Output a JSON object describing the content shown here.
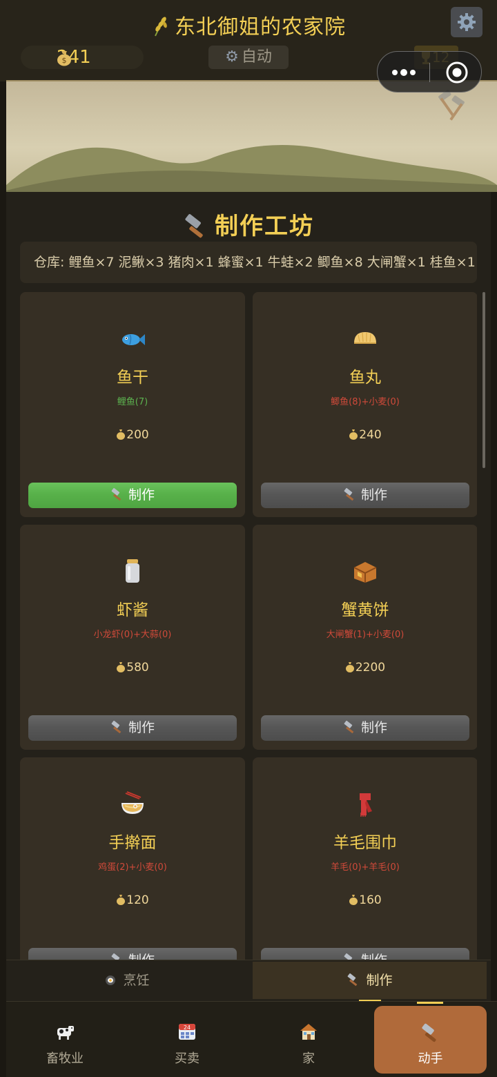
{
  "header": {
    "title": "东北御姐的农家院",
    "coins": "241",
    "auto_label": "自动",
    "trophy_count": "12"
  },
  "workshop": {
    "title": "制作工坊",
    "warehouse_text": "仓库: 鲤鱼×7 泥鳅×3 猪肉×1 蜂蜜×1 牛蛙×2 鲫鱼×8 大闸蟹×1 桂鱼×1 ...",
    "recipes": [
      {
        "name": "鱼干",
        "requires": "鲤鱼(7)",
        "price": "200",
        "button": "制作",
        "icon": "fish-icon",
        "ready": true
      },
      {
        "name": "鱼丸",
        "requires": "鲫鱼(8)+小麦(0)",
        "price": "240",
        "button": "制作",
        "icon": "dumpling-icon",
        "ready": false
      },
      {
        "name": "虾酱",
        "requires": "小龙虾(0)+大蒜(0)",
        "price": "580",
        "button": "制作",
        "icon": "jar-icon",
        "ready": false
      },
      {
        "name": "蟹黄饼",
        "requires": "大闸蟹(1)+小麦(0)",
        "price": "2200",
        "button": "制作",
        "icon": "mooncake-icon",
        "ready": false
      },
      {
        "name": "手擀面",
        "requires": "鸡蛋(2)+小麦(0)",
        "price": "120",
        "button": "制作",
        "icon": "noodle-bowl-icon",
        "ready": false
      },
      {
        "name": "羊毛围巾",
        "requires": "羊毛(0)+羊毛(0)",
        "price": "160",
        "button": "制作",
        "icon": "scarf-icon",
        "ready": false
      }
    ]
  },
  "subtabs": [
    {
      "label": "烹饪",
      "icon": "frying-pan-icon",
      "active": false
    },
    {
      "label": "制作",
      "icon": "hammer-icon",
      "active": true
    }
  ],
  "bottom_nav": [
    {
      "label": "畜牧业",
      "icon": "cow-icon",
      "active": false
    },
    {
      "label": "买卖",
      "icon": "calendar-icon",
      "active": false
    },
    {
      "label": "家",
      "icon": "house-icon",
      "active": false
    },
    {
      "label": "动手",
      "icon": "hammer-icon",
      "active": true
    }
  ],
  "colors": {
    "accent_gold": "#f3cf55",
    "ready_green": "#58b14a",
    "missing_red": "#d04a3a",
    "active_nav": "#b06a3a"
  }
}
